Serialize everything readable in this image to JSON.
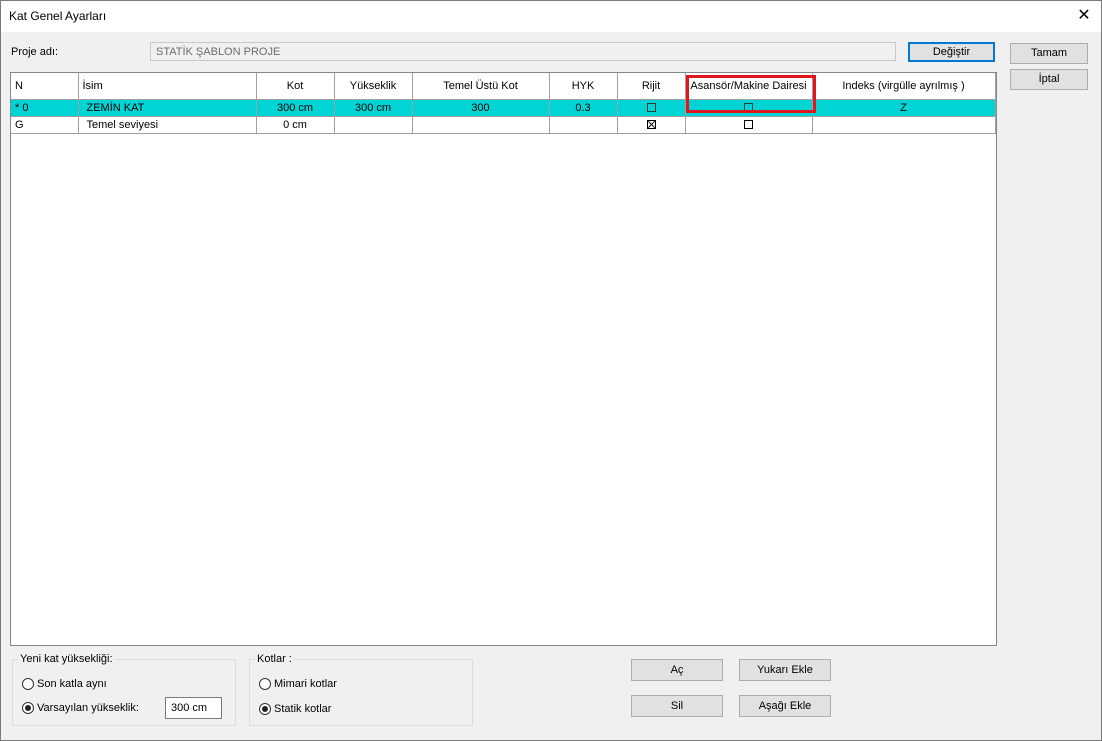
{
  "window": {
    "title": "Kat Genel Ayarları",
    "close_glyph": "✕"
  },
  "project": {
    "label": "Proje adı:",
    "value": "STATİK ŞABLON PROJE",
    "change_label": "Değiştir"
  },
  "side_buttons": {
    "ok": "Tamam",
    "cancel": "İptal"
  },
  "grid": {
    "headers": [
      "N",
      "İsim",
      "Kot",
      "Yükseklik",
      "Temel Üstü Kot",
      "HYK",
      "Rijit",
      "Asansör/Makine Dairesi",
      "Indeks (virgülle ayrılmış )"
    ],
    "rows": [
      {
        "n": "* 0",
        "isim": "ZEMİN KAT",
        "kot": "300 cm",
        "yukseklik": "300 cm",
        "temel_ustu_kot": "300",
        "hyk": "0.3",
        "rijit": false,
        "asansor": false,
        "indeks": "Z",
        "selected": true
      },
      {
        "n": "G",
        "isim": "Temel seviyesi",
        "kot": "0 cm",
        "yukseklik": "",
        "temel_ustu_kot": "",
        "hyk": "",
        "rijit": true,
        "asansor": false,
        "indeks": "",
        "selected": false
      }
    ],
    "highlight_color": "#e0161f",
    "selected_row_color": "#00d4d4"
  },
  "new_floor": {
    "title": "Yeni kat yüksekliği:",
    "option_last": "Son katla aynı",
    "option_default": "Varsayılan yükseklik:",
    "default_value": "300 cm",
    "selected": "default"
  },
  "levels": {
    "title": "Kotlar :",
    "option_arch": "Mimari kotlar",
    "option_static": "Statik kotlar",
    "selected": "static"
  },
  "actions": {
    "open": "Aç",
    "add_above": "Yukarı Ekle",
    "delete": "Sil",
    "add_below": "Aşağı Ekle"
  }
}
